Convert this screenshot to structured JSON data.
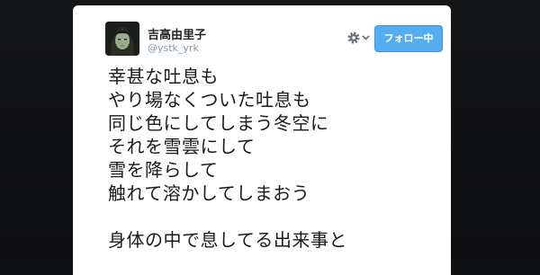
{
  "tweet": {
    "author": {
      "display_name": "吉高由里子",
      "handle": "@ystk_yrk",
      "avatar_icon": "profile-photo"
    },
    "actions": {
      "settings_icon": "gear-icon",
      "dropdown_icon": "chevron-down-icon",
      "follow_label": "フォロー中"
    },
    "body_lines": [
      "幸甚な吐息も",
      "やり場なくついた吐息も",
      "同じ色にしてしまう冬空に",
      "それを雪雲にして",
      "雪を降らして",
      "触れて溶かしてしまおう",
      "",
      "身体の中で息してる出来事と"
    ]
  },
  "colors": {
    "background": "#111214",
    "card": "#ffffff",
    "follow_button": "#55acee",
    "handle_text": "#8899a6"
  }
}
